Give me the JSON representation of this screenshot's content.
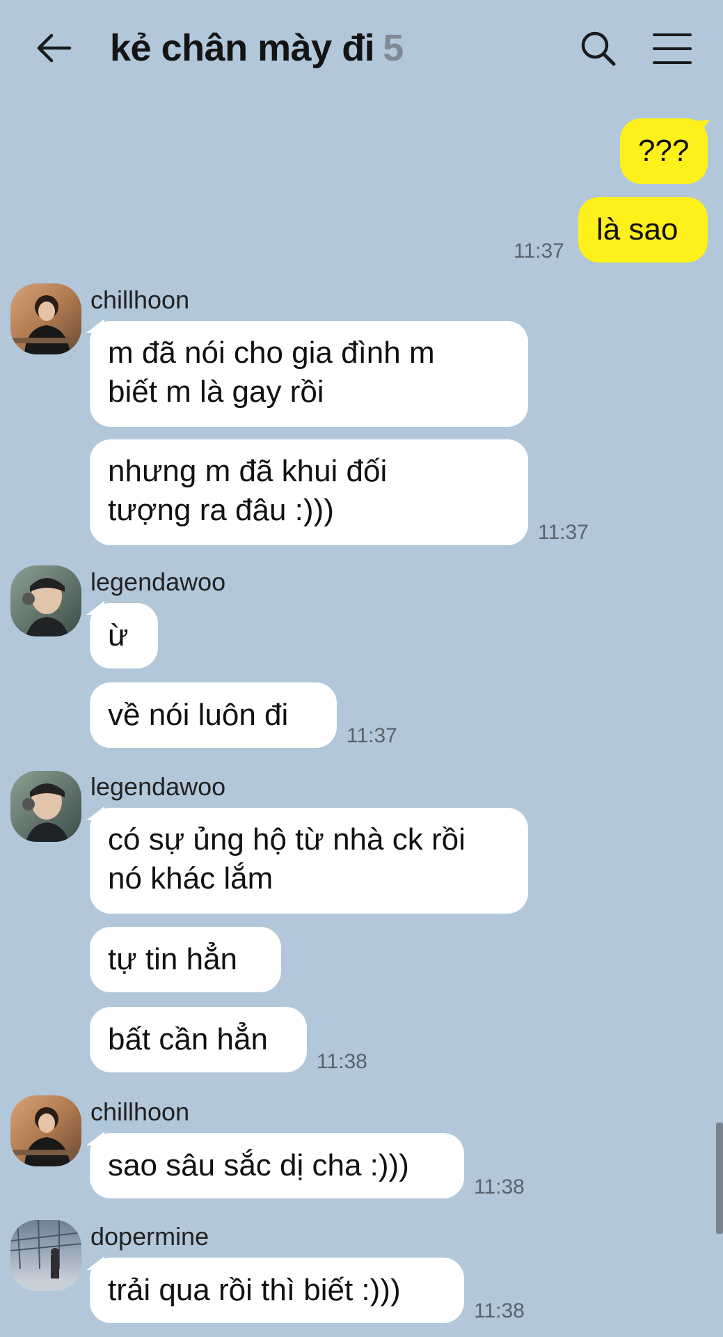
{
  "header": {
    "title": "kẻ chân mày đi",
    "member_count": "5"
  },
  "messages": {
    "m1": {
      "text": "???"
    },
    "m2": {
      "text": "là sao",
      "time": "11:37"
    },
    "g1": {
      "sender": "chillhoon",
      "line1": "m đã nói cho gia đình m",
      "line2": "biết m là gay rồi"
    },
    "g1b": {
      "line1": "nhưng m đã khui đối",
      "line2": "tượng ra đâu :)))",
      "time": "11:37"
    },
    "g2": {
      "sender": "legendawoo",
      "text": "ừ"
    },
    "g2b": {
      "text": "về nói luôn đi",
      "time": "11:37"
    },
    "g3": {
      "sender": "legendawoo",
      "line1": "có sự ủng hộ từ nhà ck rồi",
      "line2": "nó khác lắm"
    },
    "g3b": {
      "text": "tự tin hẳn"
    },
    "g3c": {
      "text": "bất cần hẳn",
      "time": "11:38"
    },
    "g4": {
      "sender": "chillhoon",
      "text": "sao sâu sắc dị cha :)))",
      "time": "11:38"
    },
    "g5": {
      "sender": "dopermine",
      "text": "trải qua rồi thì biết :)))",
      "time": "11:38"
    }
  },
  "colors": {
    "background": "#b2c7da",
    "outgoing_bubble": "#fef01b",
    "incoming_bubble": "#ffffff"
  },
  "icons": [
    "back-arrow-icon",
    "search-icon",
    "menu-icon"
  ]
}
